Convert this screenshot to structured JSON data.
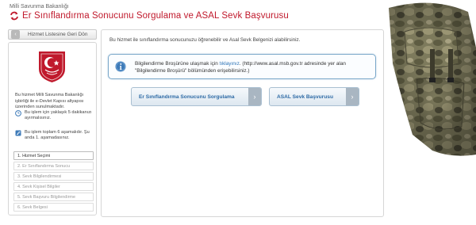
{
  "header": {
    "ministry": "Milli Savunma Bakanlığı",
    "title": "Er Sınıflandırma Sonucunu Sorgulama ve ASAL Sevk Başvurusu",
    "icon": "refresh-arrows-icon"
  },
  "sidebar": {
    "back_label": "Hizmet Listesine Geri Dön",
    "description": "Bu hizmet Milli Savunma Bakanlığı işbirliği ile e-Devlet Kapısı altyapısı üzerinden sunulmaktadır.",
    "time_info": "Bu işlem için yaklaşık 5 dakikanızı ayırmalısınız.",
    "steps_info": "Bu işlem toplam 6 aşamalıdır. Şu anda 1. aşamadasınız.",
    "steps": [
      "1. Hizmet Seçimi",
      "2. Er Sınıflandırma Sonucu",
      "3. Sevk Bilgilendirmesi",
      "4. Sevk Kişisel Bilgiler",
      "5. Sevk Başvuru Bilgilendirme",
      "6. Sevk Belgesi"
    ],
    "active_step": 1
  },
  "main": {
    "intro": "Bu hizmet ile sınıflandırma sonucunuzu öğrenebilir ve Asal Sevk Belgenizi alabilirsiniz.",
    "notice_prefix": "Bilgilendirme Broşürüne ulaşmak için ",
    "notice_link": "tıklayınız",
    "notice_suffix": ". (http://www.asal.msb.gov.tr adresinde yer alan \"Bilgilendirme Broşürü\" bölümünden erişebilirsiniz.)",
    "button_query": "Er Sınıflandırma Sonucunu Sorgulama",
    "button_asal": "ASAL Sevk Başvurusu"
  },
  "colors": {
    "title_red": "#c0192c",
    "link_blue": "#2a72b5",
    "notice_border": "#79a7c9"
  }
}
